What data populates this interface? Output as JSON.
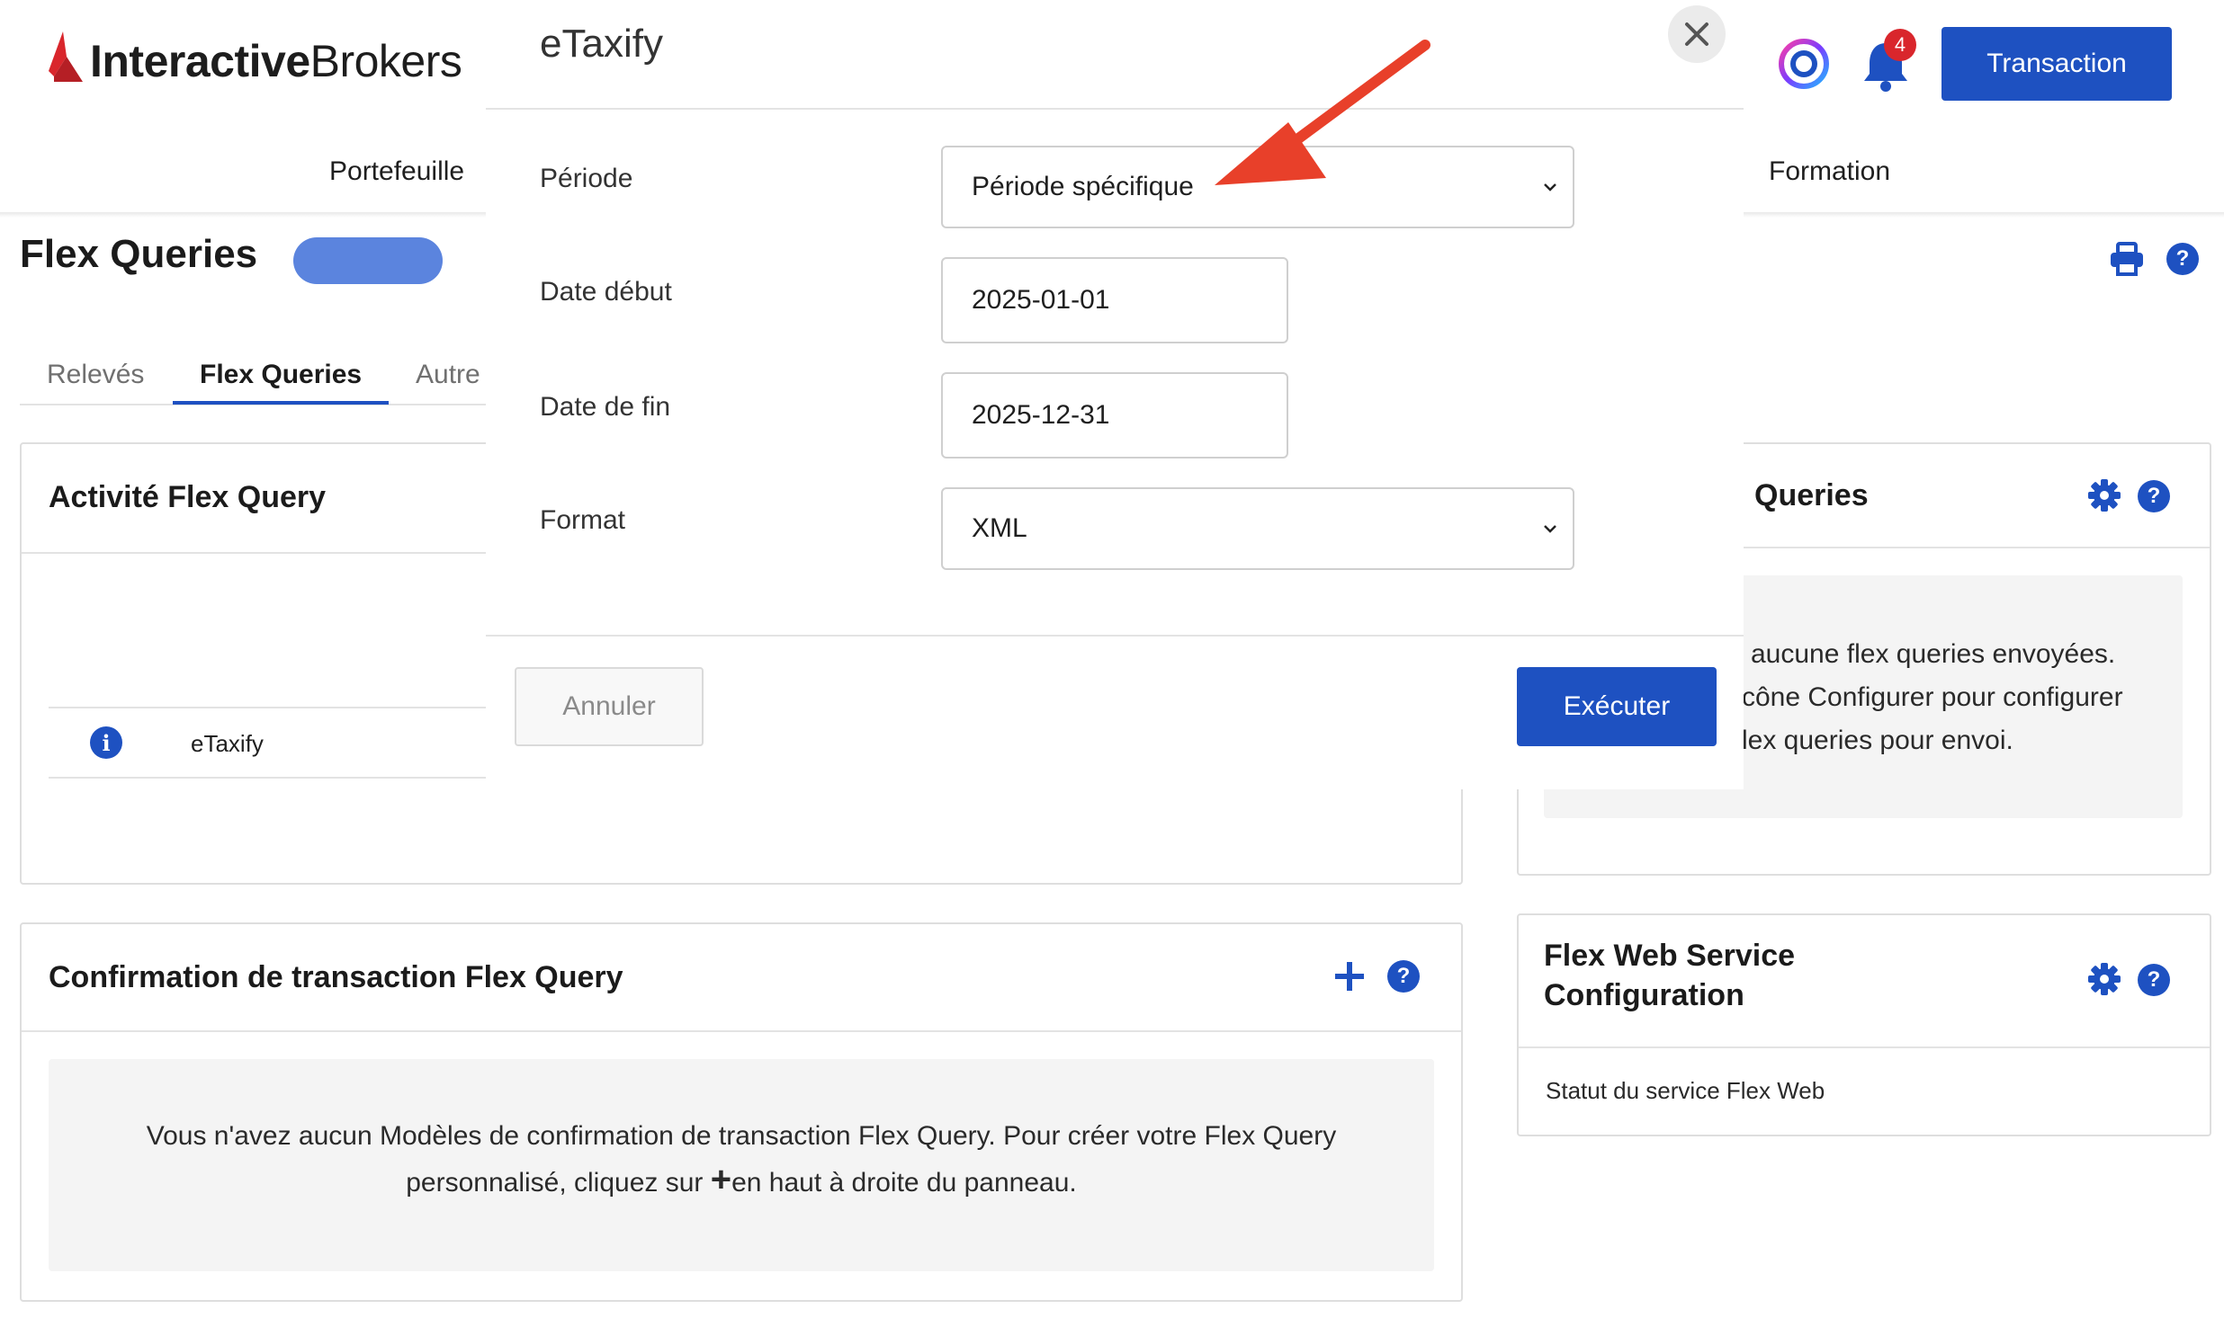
{
  "header": {
    "brand_bold": "Interactive",
    "brand_regular": "Brokers",
    "nav": {
      "portfolio": "Portefeuille",
      "education": "Formation"
    },
    "notification_count": "4",
    "trade_button": "Transaction"
  },
  "page": {
    "title": "Flex Queries",
    "tabs": [
      "Relevés",
      "Flex Queries",
      "Autre"
    ]
  },
  "activity_panel": {
    "title": "Activité Flex Query",
    "row_name": "eTaxify"
  },
  "delivery_panel": {
    "title_fragment": "Queries",
    "empty_line1": "aucune flex queries envoyées.",
    "empty_line2": "cône Configurer pour configurer",
    "empty_line3": "lex queries pour envoi."
  },
  "trade_confirm_panel": {
    "title": "Confirmation de transaction Flex Query",
    "empty_line1": "Vous n'avez aucun Modèles de confirmation de transaction Flex Query. Pour créer votre Flex Query",
    "empty_line2_before": "personnalisé, cliquez sur ",
    "empty_line2_plus": "+",
    "empty_line2_after": "en haut à droite du panneau."
  },
  "web_service_panel": {
    "title_line1": "Flex Web Service",
    "title_line2": "Configuration",
    "status_label": "Statut du service Flex Web"
  },
  "modal": {
    "title": "eTaxify",
    "period_label": "Période",
    "period_value": "Période spécifique",
    "start_label": "Date début",
    "start_value": "2025-01-01",
    "end_label": "Date de fin",
    "end_value": "2025-12-31",
    "format_label": "Format",
    "format_value": "XML",
    "cancel_button": "Annuler",
    "run_button": "Exécuter"
  },
  "colors": {
    "primary": "#1e51c1",
    "brand_red": "#d9262c",
    "annotation_arrow": "#e8402a",
    "title_pill": "#5b84de"
  },
  "icons": [
    "ib-logo-icon",
    "circle-logo-icon",
    "bell-icon",
    "close-icon",
    "print-icon",
    "help-icon",
    "gear-icon",
    "info-icon",
    "plus-icon",
    "chevron-down-icon",
    "arrow-annotation-icon"
  ]
}
